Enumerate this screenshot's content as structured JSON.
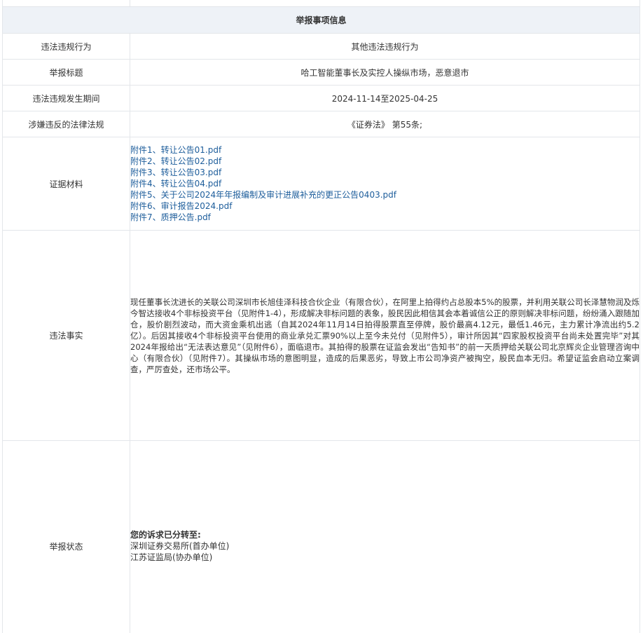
{
  "section_title": "举报事项信息",
  "rows": {
    "violation_type": {
      "label": "违法违规行为",
      "value": "其他违法违规行为"
    },
    "report_title": {
      "label": "举报标题",
      "value": "哈工智能董事长及实控人操纵市场，恶意退市"
    },
    "period": {
      "label": "违法违规发生期间",
      "value": "2024-11-14至2025-04-25"
    },
    "laws": {
      "label": "涉嫌违反的法律法规",
      "value": "《证券法》 第55条;"
    },
    "evidence": {
      "label": "证据材料",
      "files": [
        "附件1、转让公告01.pdf",
        "附件2、转让公告02.pdf",
        "附件3、转让公告03.pdf",
        "附件4、转让公告04.pdf",
        "附件5、关于公司2024年年报编制及审计进展补充的更正公告0403.pdf",
        "附件6、审计报告2024.pdf",
        "附件7、质押公告.pdf"
      ]
    },
    "facts": {
      "label": "违法事实",
      "text": "现任董事长沈进长的关联公司深圳市长旭佳泽科技合伙企业（有限合伙），在阿里上拍得约占总股本5%的股票，并利用关联公司长泽慧物润及烁今智达接收4个非标投资平台（见附件1-4），形成解决非标问题的表象，股民因此相信其会本着诚信公正的原则解决非标问题，纷纷涌入跟随加仓，股价剧烈波动，而大资金乘机出逃（自其2024年11月14日拍得股票直至停牌，股价最高4.12元，最低1.46元，主力累计净流出约5.2亿）。后因其接收4个非标投资平台使用的商业承兑汇票90%以上至今未兑付（见附件5），审计所因其“四家股权投资平台尚未处置完毕”对其2024年报给出“无法表达意见”（见附件6），面临退市。其拍得的股票在证监会发出“告知书”的前一天质押给关联公司北京辉炎企业管理咨询中心（有限合伙）（见附件7）。其操纵市场的意图明显，造成的后果恶劣，导致上市公司净资产被掏空，股民血本无归。希望证监会启动立案调查，严厉查处，还市场公平。"
    },
    "status": {
      "label": "举报状态",
      "title": "您的诉求已分转至:",
      "lines": [
        "深圳证券交易所(首办单位)",
        "江苏证监局(协办单位)"
      ]
    }
  },
  "colors": {
    "header_bg": "#eef2f7",
    "border": "#e3e6ea",
    "link": "#1d5d9b",
    "text": "#333333"
  }
}
